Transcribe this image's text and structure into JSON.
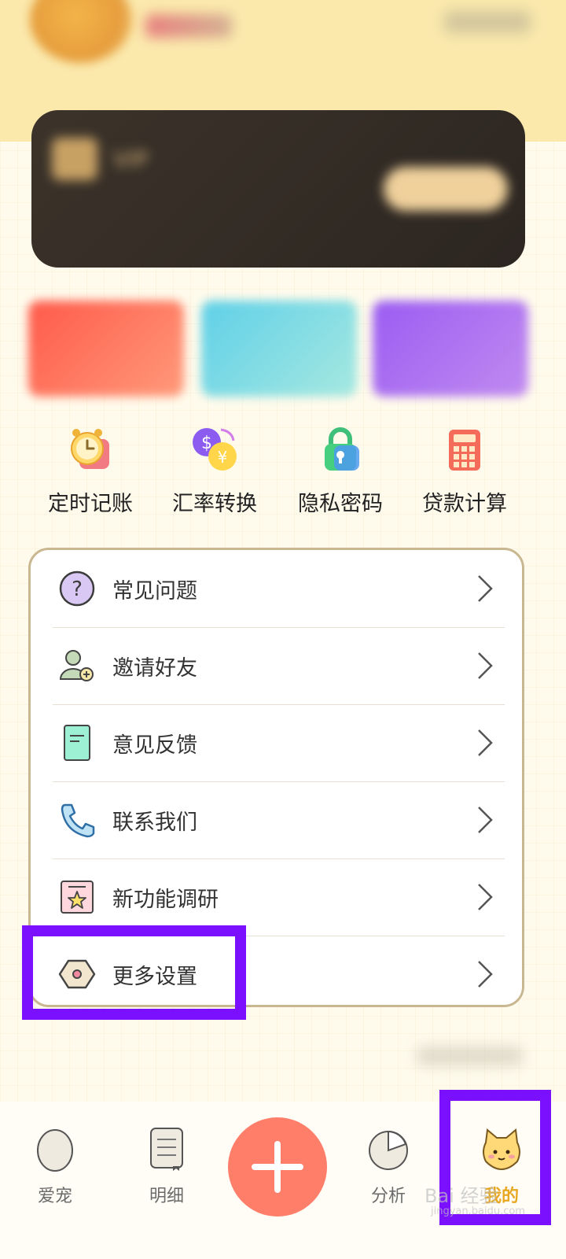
{
  "tools": [
    {
      "label": "定时记账",
      "icon": "alarm-clock-icon"
    },
    {
      "label": "汇率转换",
      "icon": "currency-exchange-icon"
    },
    {
      "label": "隐私密码",
      "icon": "lock-icon"
    },
    {
      "label": "贷款计算",
      "icon": "calculator-icon"
    }
  ],
  "menu": [
    {
      "label": "常见问题",
      "icon": "question-icon"
    },
    {
      "label": "邀请好友",
      "icon": "invite-friend-icon"
    },
    {
      "label": "意见反馈",
      "icon": "feedback-document-icon"
    },
    {
      "label": "联系我们",
      "icon": "phone-icon"
    },
    {
      "label": "新功能调研",
      "icon": "survey-star-icon"
    },
    {
      "label": "更多设置",
      "icon": "settings-hexagon-icon"
    }
  ],
  "tabs": [
    {
      "label": "爱宠",
      "icon": "egg-icon"
    },
    {
      "label": "明细",
      "icon": "notebook-icon"
    },
    {
      "label": "分析",
      "icon": "pie-chart-icon"
    },
    {
      "label": "我的",
      "icon": "cat-face-icon"
    }
  ],
  "watermark": {
    "text": "Bai 经验",
    "sub": "jingyan.baidu.com"
  },
  "colors": {
    "accent_tab": "#e8a720",
    "add_button": "#ff7e6a",
    "highlight": "#7b10ff"
  }
}
